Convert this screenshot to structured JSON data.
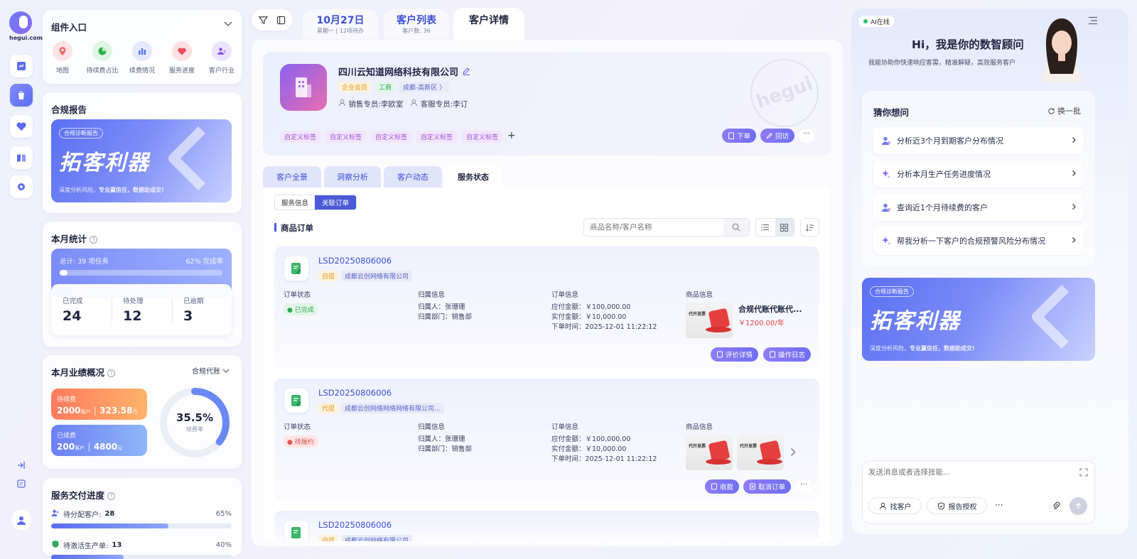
{
  "logo": {
    "text": "hegui.com"
  },
  "components": {
    "title": "组件入口",
    "items": [
      {
        "label": "地图",
        "icon": "map-pin-icon",
        "color": "#f06a6a",
        "bg": "#fde3e3"
      },
      {
        "label": "待续费占比",
        "icon": "pie-chart-icon",
        "color": "#2fb24b",
        "bg": "#e0f6e4"
      },
      {
        "label": "续费情况",
        "icon": "bar-chart-icon",
        "color": "#5876f0",
        "bg": "#e3e8fc"
      },
      {
        "label": "服务进度",
        "icon": "heart-icon",
        "color": "#ef4b5b",
        "bg": "#fde0e3"
      },
      {
        "label": "客户行业",
        "icon": "users-icon",
        "color": "#8458e8",
        "bg": "#ede3fd"
      }
    ]
  },
  "compliance": {
    "title": "合规报告",
    "banner_tag": "合规诊断报告",
    "banner_big": "拓客利器",
    "banner_sub_a": "深度分析风险，",
    "banner_sub_b": "专业赢信任，数据助成交!"
  },
  "monthly": {
    "title": "本月统计",
    "total": "总计: 39 项任务",
    "rate": "62% 完成率",
    "progress": 0.62,
    "items": [
      {
        "label": "已完成",
        "value": "24"
      },
      {
        "label": "待处理",
        "value": "12"
      },
      {
        "label": "已逾期",
        "value": "3"
      }
    ]
  },
  "perf": {
    "title": "本月业绩概况",
    "filter": "合规代账",
    "pending": {
      "label": "待续费",
      "count": "2000",
      "count_unit": "客户",
      "amount": "323.58",
      "amount_unit": "万元"
    },
    "renewed": {
      "label": "已续费",
      "count": "200",
      "count_unit": "客户",
      "amount": "4800",
      "amount_unit": "元"
    },
    "donut_value": "35.5%",
    "donut_label": "续费率",
    "donut_ratio": 0.355
  },
  "delivery": {
    "title": "服务交付进度",
    "rows": [
      {
        "label": "待分配客户:",
        "value": "28",
        "pct": "65%",
        "ratio": 0.65
      },
      {
        "label": "待激活生产单:",
        "value": "13",
        "pct": "40%",
        "ratio": 0.4
      }
    ]
  },
  "toptabs": [
    {
      "main": "10月27日",
      "sub": "星期一 | 12项待办"
    },
    {
      "main": "客户列表",
      "sub": "客户数: 36"
    },
    {
      "main": "客户详情",
      "sub": ""
    }
  ],
  "customer": {
    "name": "四川云知道网络科技有限公司",
    "chips": [
      {
        "text": "企业会员",
        "color": "#e49a1f",
        "bg": "#fdf2dd"
      },
      {
        "text": "工商",
        "color": "#2fa85a",
        "bg": "#e2f5e8"
      },
      {
        "text": "成都-高新区 〉",
        "color": "#5a63c8",
        "bg": "#e8eaf8"
      }
    ],
    "sales_label": "销售专员:",
    "sales": "李欧室",
    "service_label": "客服专员:",
    "service": "李订",
    "tags": [
      "自定义标签",
      "自定义标签",
      "自定义标签",
      "自定义标签",
      "自定义标签"
    ],
    "add": "+",
    "btn_order": "下单",
    "btn_visit": "回访",
    "more": "···",
    "watermark": "hegui"
  },
  "subtabs": [
    "客户全景",
    "洞察分析",
    "客户动态",
    "服务状态"
  ],
  "toggle": [
    "服务信息",
    "关联订单"
  ],
  "section_title": "商品订单",
  "search": {
    "placeholder": "商品名称/客户名称"
  },
  "orders": [
    {
      "no": "LSD20250806006",
      "type": "自提",
      "company": "成都云创网络有限公司",
      "status": "已完成",
      "status_color": "#2fa85a",
      "status_bg": "#e2f5e8",
      "labels": [
        "订单状态",
        "归属信息",
        "订单信息",
        "商品信息"
      ],
      "owner": "归属人：张珊珊",
      "dept": "归属部门：销售部",
      "due": "应付金额：￥100,000.00",
      "paid": "实付金额：￥10,000.00",
      "time": "下单时间：2025-12-01 11:22:12",
      "product_name": "合规代账代账代...",
      "product_price": "￥1200.00/年",
      "product_img": "代开发票",
      "btns": [
        "评价详情",
        "操作日志"
      ]
    },
    {
      "no": "LSD20250806006",
      "type": "代提",
      "company": "成都云创网络网络网络有限公司...",
      "status": "待履约",
      "status_color": "#e0554d",
      "status_bg": "#fce6e4",
      "labels": [
        "订单状态",
        "归属信息",
        "订单信息",
        "商品信息"
      ],
      "owner": "归属人：张珊珊",
      "dept": "归属部门：销售部",
      "due": "应付金额：￥100,000.00",
      "paid": "实付金额：￥10,000.00",
      "time": "下单时间：2025-12-01 11:22:12",
      "product_img": "代开发票",
      "product_img2": "代开发票",
      "btns": [
        "收款",
        "取消订单"
      ],
      "more": "···"
    },
    {
      "no": "LSD20250806006",
      "type": "自提",
      "company": "成都云创网络有限公司"
    }
  ],
  "ai": {
    "status": "AI在线",
    "greet": "Hi，我是你的数智顾问",
    "desc": "我能协助你快速响应客需，精准解疑，高效服务客户",
    "guess_title": "猜你想问",
    "refresh": "换一批",
    "suggestions": [
      {
        "text": "分析近3个月到期客户分布情况",
        "icon": "user-icon"
      },
      {
        "text": "分析本月生产任务进度情况",
        "icon": "sparkle-icon"
      },
      {
        "text": "查询近1个月待续费的客户",
        "icon": "user-icon"
      },
      {
        "text": "帮我分析一下客户的合规预警风险分布情况",
        "icon": "sparkle-icon"
      }
    ],
    "banner_tag": "合规诊断报告",
    "banner_big": "拓客利器",
    "banner_sub_a": "深度分析风险，",
    "banner_sub_b": "专业赢信任，数据助成交!",
    "input_placeholder": "发送消息或者选择技能...",
    "btn_find": "找客户",
    "btn_report": "报告授权",
    "more": "···"
  }
}
